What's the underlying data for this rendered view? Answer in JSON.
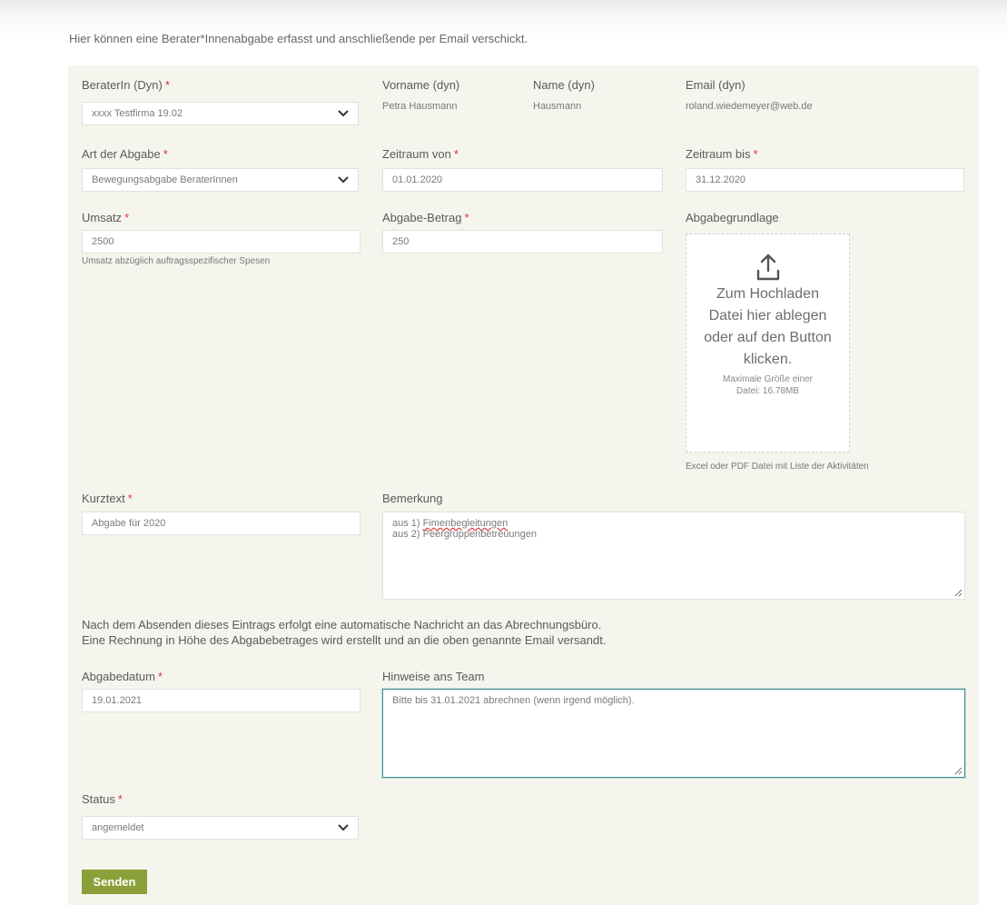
{
  "intro": "Hier können eine Berater*Innenabgabe erfasst und anschließende per Email verschickt.",
  "required_mark": "*",
  "colors": {
    "panel": "#f5f5ee",
    "required": "#d9334a",
    "button": "#8ca03a",
    "focus_border": "#3f8f8f"
  },
  "icons": {
    "select": "chevron-down-icon",
    "upload": "upload-icon"
  },
  "berater": {
    "label": "BeraterIn (Dyn)",
    "value": "xxxx Testfirma 19.02"
  },
  "vorname": {
    "label": "Vorname (dyn)",
    "value": "Petra Hausmann"
  },
  "name": {
    "label": "Name (dyn)",
    "value": "Hausmann"
  },
  "email": {
    "label": "Email (dyn)",
    "value": "roland.wiedemeyer@web.de"
  },
  "art": {
    "label": "Art der Abgabe",
    "value": "Bewegungsabgabe BeraterInnen"
  },
  "zeitraum_von": {
    "label": "Zeitraum von",
    "value": "01.01.2020"
  },
  "zeitraum_bis": {
    "label": "Zeitraum bis",
    "value": "31.12.2020"
  },
  "umsatz": {
    "label": "Umsatz",
    "value": "2500",
    "help": "Umsatz abzüglich auftragsspezifischer Spesen"
  },
  "betrag": {
    "label": "Abgabe-Betrag",
    "value": "250"
  },
  "grundlage": {
    "label": "Abgabegrundlage",
    "drop_text": "Zum Hochladen Datei hier ablegen oder auf den Button klicken.",
    "max_size": "Maximale Größe einer Datei: 16.78MB",
    "help": "Excel oder PDF Datei mit Liste der Aktivitäten"
  },
  "kurztext": {
    "label": "Kurztext",
    "value": "Abgabe für 2020"
  },
  "bemerkung": {
    "label": "Bemerkung",
    "line1_prefix": "aus 1) ",
    "line1_word": "Fimenbegleitungen",
    "line2": "aus 2) Peergruppenbetreuungen"
  },
  "notice": {
    "line1": "Nach dem Absenden dieses Eintrags erfolgt eine automatische Nachricht an das Abrechnungsbüro.",
    "line2": "Eine Rechnung in Höhe des Abgabebetrages wird erstellt und an die oben genannte Email versandt."
  },
  "abgabedatum": {
    "label": "Abgabedatum",
    "value": "19.01.2021"
  },
  "hinweise": {
    "label": "Hinweise ans Team",
    "value": "Bitte bis 31.01.2021 abrechnen (wenn irgend möglich)."
  },
  "status": {
    "label": "Status",
    "value": "angemeldet"
  },
  "submit_label": "Senden"
}
